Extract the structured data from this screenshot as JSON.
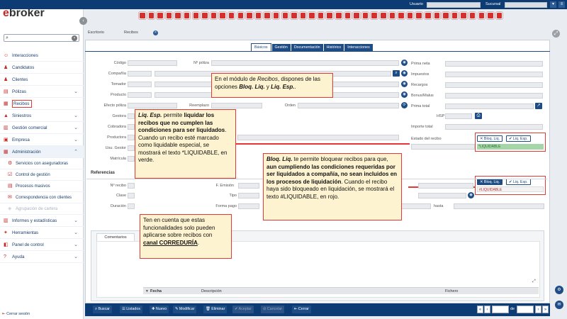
{
  "app": {
    "logo_prefix": "e",
    "logo_rest": "broker"
  },
  "topbar": {
    "usuario_label": "Usuario",
    "sucursal_label": "Sucursal"
  },
  "sidebar": {
    "search_placeholder": "",
    "items": [
      {
        "label": "Interacciones",
        "icon": "people-icon"
      },
      {
        "label": "Candidatos",
        "icon": "user-plus-icon"
      },
      {
        "label": "Clientes",
        "icon": "users-icon"
      },
      {
        "label": "Pólizas",
        "icon": "folder-icon",
        "expandable": true
      },
      {
        "label": "Recibos",
        "icon": "receipt-icon",
        "highlighted": true
      },
      {
        "label": "Siniestros",
        "icon": "car-icon",
        "expandable": true
      },
      {
        "label": "Gestión comercial",
        "icon": "chart-icon",
        "expandable": true
      },
      {
        "label": "Empresa",
        "icon": "building-icon",
        "expandable": true
      },
      {
        "label": "Administración",
        "icon": "calc-icon",
        "expanded": true
      },
      {
        "label": "Servicios con aseguradoras",
        "icon": "gear-icon",
        "sub": true
      },
      {
        "label": "Control de gestión",
        "icon": "check-icon",
        "sub": true
      },
      {
        "label": "Procesos masivos",
        "icon": "process-icon",
        "sub": true
      },
      {
        "label": "Correspondencia con clientes",
        "icon": "mail-icon",
        "sub": true
      },
      {
        "label": "Agrupación de cartera",
        "icon": "group-icon",
        "sub": true,
        "disabled": true
      },
      {
        "label": "Informes y estadísticas",
        "icon": "report-icon",
        "expandable": true
      },
      {
        "label": "Herramientas",
        "icon": "tools-icon",
        "expandable": true
      },
      {
        "label": "Panel de control",
        "icon": "panel-icon",
        "expandable": true
      },
      {
        "label": "Ayuda",
        "icon": "help-icon",
        "expandable": true
      }
    ],
    "logout": "Cerrar sesión"
  },
  "tabs": {
    "t1": "Escritorio",
    "t2": "Recibos"
  },
  "subtabs": [
    "Básicos",
    "Gestión",
    "Documentación",
    "Histórico",
    "Interacciones"
  ],
  "form": {
    "codigo": "Código",
    "n_poliza": "Nº póliza",
    "compania": "Compañía",
    "tomador": "Tomador",
    "producto": "Producto",
    "efecto_poliza": "Efecto póliza",
    "reemplazo": "Reemplazo",
    "orden": "Orden",
    "gestora": "Gestora",
    "cobradora": "Cobradora",
    "productora": "Productora",
    "usu_gestor": "Usu. Gestor",
    "matricula": "Matrícula",
    "prima_neta": "Prima neta",
    "impuestos": "Impuestos",
    "recargos": "Recargos",
    "bonus_malus": "Bonus/Malus",
    "prima_total": "Prima total",
    "hsp": "HSP",
    "importe_total": "Importe total",
    "estado_recibo": "Estado del recibo"
  },
  "status": {
    "bloq_label": "Bloq. Liq.",
    "liq_label": "Liq. Esp.",
    "liquidable_green": "*LIQUIDABLE",
    "liquidable_red": "#LIQUIDABLE"
  },
  "referencias": {
    "title": "Referencias",
    "n_recibo": "Nº recibo",
    "f_emision": "F. Emisión",
    "clase": "Clase",
    "tipo": "Tipo",
    "duracion": "Duración",
    "forma_pago": "Forma pago",
    "hasta": "hasta"
  },
  "comments": {
    "tab": "Comentarios",
    "col_fecha": "Fecha",
    "col_descripcion": "Descripción",
    "col_fichero": "Fichero"
  },
  "bottombar": {
    "buscar": "Buscar",
    "listados": "Listados",
    "nuevo": "Nuevo",
    "modificar": "Modificar",
    "eliminar": "Eliminar",
    "aceptar": "Aceptar",
    "cancelar": "Cancelar",
    "cerrar": "Cerrar",
    "de": "de"
  },
  "callouts": {
    "c1_p1": "En el módulo de ",
    "c1_i": "Recibos",
    "c1_p2": ", dispones de las opciones ",
    "c1_b1": "Bloq. Liq.",
    "c1_p3": " y ",
    "c1_b2": "Liq. Esp.",
    "c1_p4": ".",
    "c2_bi": "Liq. Esp.",
    "c2_p1": " permite ",
    "c2_b1": "liquidar los recibos que no cumplen las condiciones para ser liquidados",
    "c2_p2": ". Cuando un recibo esté marcado como liquidable especial, se mostrará el texto *LIQUIDABLE, en verde.",
    "c3_bi": "Bloq. Liq.",
    "c3_p1": " te permite bloquear recibos para que, ",
    "c3_b1": "aun cumpliendo las condiciones requeridas por ser liquidados a compañía, no sean incluidos en los procesos de liquidación",
    "c3_p2": ". Cuando el recibo haya sido bloqueado en liquidación, se mostrará el texto #LIQUIDABLE, en rojo.",
    "c4_p1": "Ten en cuenta que estas funcionalidades solo pueden aplicarse sobre recibos con ",
    "c4_bu": "canal CORREDURÍA",
    "c4_p2": "."
  }
}
